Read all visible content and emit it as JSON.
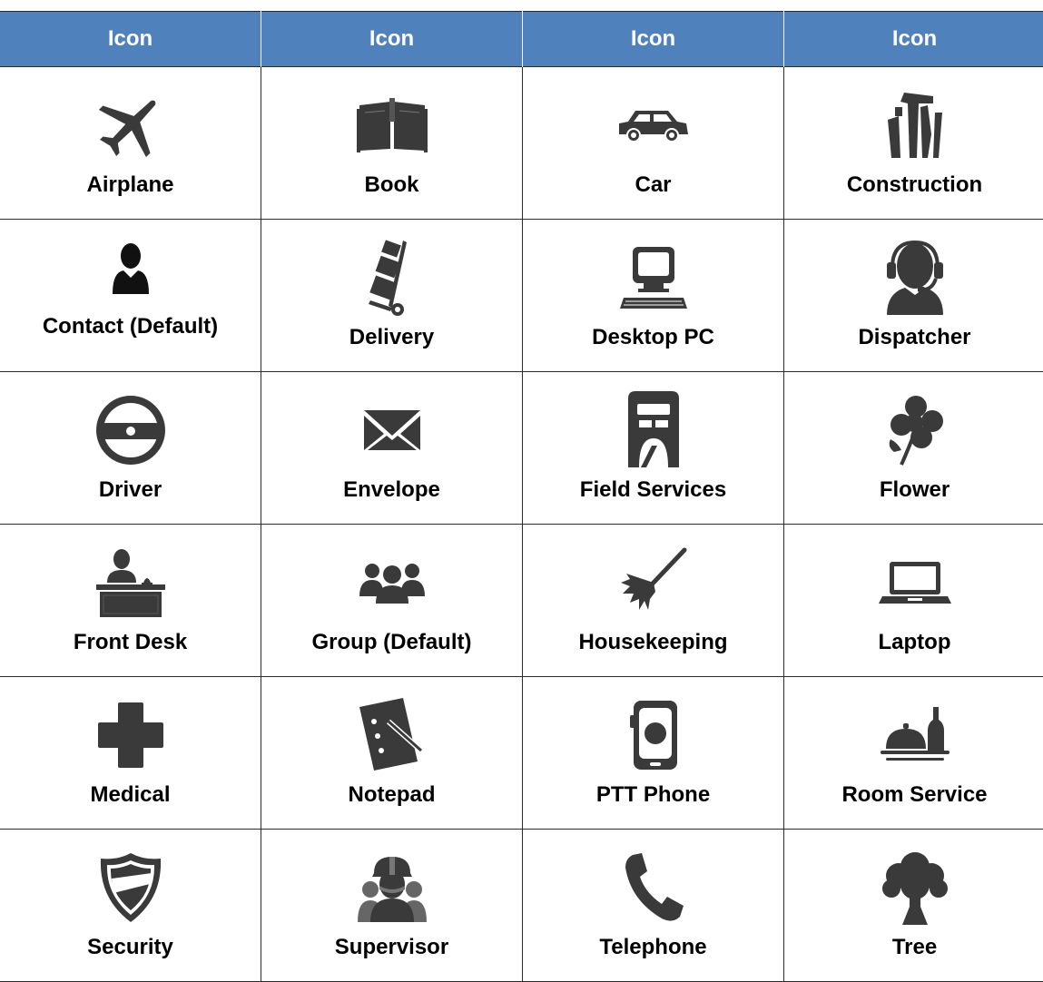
{
  "table": {
    "headers": [
      "Icon",
      "Icon",
      "Icon",
      "Icon"
    ],
    "icon_color": "#3a3a3a",
    "header_color": "#4f81bd",
    "rows": [
      [
        {
          "label": "Airplane",
          "icon": "airplane-icon"
        },
        {
          "label": "Book",
          "icon": "book-icon"
        },
        {
          "label": "Car",
          "icon": "car-icon"
        },
        {
          "label": "Construction",
          "icon": "construction-icon"
        }
      ],
      [
        {
          "label": "Contact (Default)",
          "icon": "contact-icon"
        },
        {
          "label": "Delivery",
          "icon": "delivery-icon"
        },
        {
          "label": "Desktop PC",
          "icon": "desktop-pc-icon"
        },
        {
          "label": "Dispatcher",
          "icon": "dispatcher-icon"
        }
      ],
      [
        {
          "label": "Driver",
          "icon": "driver-icon"
        },
        {
          "label": "Envelope",
          "icon": "envelope-icon"
        },
        {
          "label": "Field Services",
          "icon": "field-services-icon"
        },
        {
          "label": "Flower",
          "icon": "flower-icon"
        }
      ],
      [
        {
          "label": "Front Desk",
          "icon": "front-desk-icon"
        },
        {
          "label": "Group (Default)",
          "icon": "group-icon"
        },
        {
          "label": "Housekeeping",
          "icon": "housekeeping-icon"
        },
        {
          "label": "Laptop",
          "icon": "laptop-icon"
        }
      ],
      [
        {
          "label": "Medical",
          "icon": "medical-icon"
        },
        {
          "label": "Notepad",
          "icon": "notepad-icon"
        },
        {
          "label": "PTT Phone",
          "icon": "ptt-phone-icon"
        },
        {
          "label": "Room Service",
          "icon": "room-service-icon"
        }
      ],
      [
        {
          "label": "Security",
          "icon": "security-icon"
        },
        {
          "label": "Supervisor",
          "icon": "supervisor-icon"
        },
        {
          "label": "Telephone",
          "icon": "telephone-icon"
        },
        {
          "label": "Tree",
          "icon": "tree-icon"
        }
      ]
    ]
  }
}
